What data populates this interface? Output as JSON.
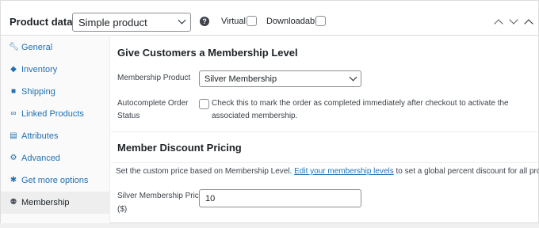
{
  "header": {
    "title": "Product data —",
    "product_type": "Simple product",
    "virtual_label": "Virtual:",
    "downloadable_label": "Downloadable:"
  },
  "sidebar": {
    "items": [
      {
        "label": "General",
        "icon": "wrench-icon"
      },
      {
        "label": "Inventory",
        "icon": "tag-icon"
      },
      {
        "label": "Shipping",
        "icon": "truck-icon"
      },
      {
        "label": "Linked Products",
        "icon": "link-icon"
      },
      {
        "label": "Attributes",
        "icon": "table-icon"
      },
      {
        "label": "Advanced",
        "icon": "gear-icon"
      },
      {
        "label": "Get more options",
        "icon": "plugin-icon"
      },
      {
        "label": "Membership",
        "icon": "membership-icon",
        "active": true
      }
    ]
  },
  "membership": {
    "heading": "Give Customers a Membership Level",
    "product_label": "Membership Product",
    "product_value": "Silver Membership",
    "autocomplete_label_1": "Autocomplete Order",
    "autocomplete_label_2": "Status",
    "autocomplete_desc_1": "Check this to mark the order as completed immediately after checkout to activate the",
    "autocomplete_desc_2": "associated membership."
  },
  "discount": {
    "heading": "Member Discount Pricing",
    "desc_before": "Set the custom price based on Membership Level.",
    "desc_link": "Edit your membership levels",
    "desc_after": "to set a global percent discount for all products.",
    "price_label_1": "Silver Membership Price",
    "price_label_2": "($)",
    "price_value": "10"
  }
}
